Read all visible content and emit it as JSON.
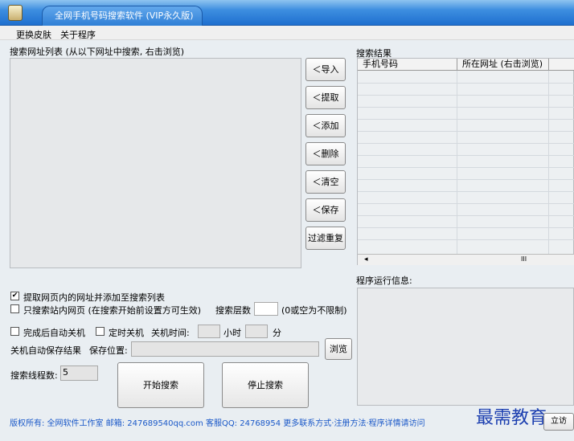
{
  "window": {
    "title": "全网手机号码搜索软件 (VIP永久版)"
  },
  "menu": {
    "items": [
      "更换皮肤",
      "关于程序"
    ]
  },
  "left": {
    "list_label": "搜索网址列表 (从以下网址中搜索, 右击浏览)",
    "buttons": [
      "＜导入",
      "＜提取",
      "＜添加",
      "＜删除",
      "＜清空",
      "＜保存",
      "过滤重复"
    ]
  },
  "results": {
    "label": "搜索结果",
    "columns": [
      "手机号码",
      "所在网址 (右击浏览)"
    ],
    "scroll_indicator": "III",
    "scroll_left": "◂"
  },
  "options": {
    "extract_links_label": "提取网页内的网址并添加至搜索列表",
    "extract_links_checked": true,
    "site_only_label": "只搜索站内网页 (在搜索开始前设置方可生效)",
    "site_only_checked": false,
    "depth_label": "搜索层数",
    "depth_value": "",
    "depth_hint": "(0或空为不限制)",
    "shutdown_after_label": "完成后自动关机",
    "shutdown_after_checked": false,
    "timer_shutdown_label": "定时关机",
    "timer_shutdown_checked": false,
    "shutdown_time_label": "关机时间:",
    "hour_value": "",
    "hour_unit": "小时",
    "minute_value": "",
    "minute_unit": "分",
    "autosave_label": "关机自动保存结果",
    "save_location_label": "保存位置:",
    "save_location_value": "",
    "browse_label": "浏览",
    "threads_label": "搜索线程数:",
    "threads_value": "5"
  },
  "actions": {
    "start_label": "开始搜索",
    "stop_label": "停止搜索"
  },
  "log": {
    "label": "程序运行信息:"
  },
  "footer": {
    "text": "版权所有: 全网软件工作室  邮箱: 247689540qq.com 客服QQ: 24768954 更多联系方式·注册方法·程序详情请访问",
    "right_button": "立访"
  },
  "watermark": "最需教育",
  "colors": {
    "title_blue": "#1f6fcf",
    "footer_link": "#1a58c8"
  }
}
